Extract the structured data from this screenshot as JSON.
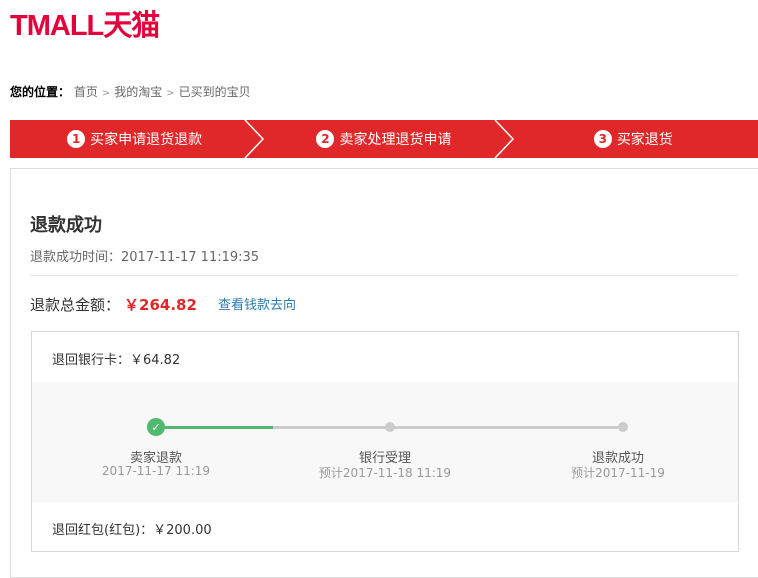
{
  "logo": "TMALL天猫",
  "breadcrumb": {
    "label": "您的位置：",
    "items": [
      "首页",
      "我的淘宝",
      "已买到的宝贝"
    ],
    "separator": ">"
  },
  "steps": [
    {
      "num": "1",
      "label": "买家申请退货退款"
    },
    {
      "num": "2",
      "label": "卖家处理退货申请"
    },
    {
      "num": "3",
      "label": "买家退货"
    }
  ],
  "refund": {
    "title": "退款成功",
    "time": "退款成功时间：2017-11-17 11:19:35",
    "total_label": "退款总金额：",
    "total_amount": "￥264.82",
    "trace_link": "查看钱款去向"
  },
  "bank": {
    "text": "退回银行卡：￥64.82"
  },
  "progress": {
    "completed_fraction": 0.25,
    "nodes": [
      {
        "label": "卖家退款",
        "date": "2017-11-17 11:19"
      },
      {
        "label": "银行受理",
        "date": "预计2017-11-18 11:19"
      },
      {
        "label": "退款成功",
        "date": "预计2017-11-19"
      }
    ]
  },
  "red_packet": {
    "text": "退回红包(红包)：￥200.00"
  },
  "colors": {
    "brand": "#e4003a",
    "steps_bg": "#e0282a",
    "success": "#4fba6f",
    "link": "#2a7ab0"
  }
}
